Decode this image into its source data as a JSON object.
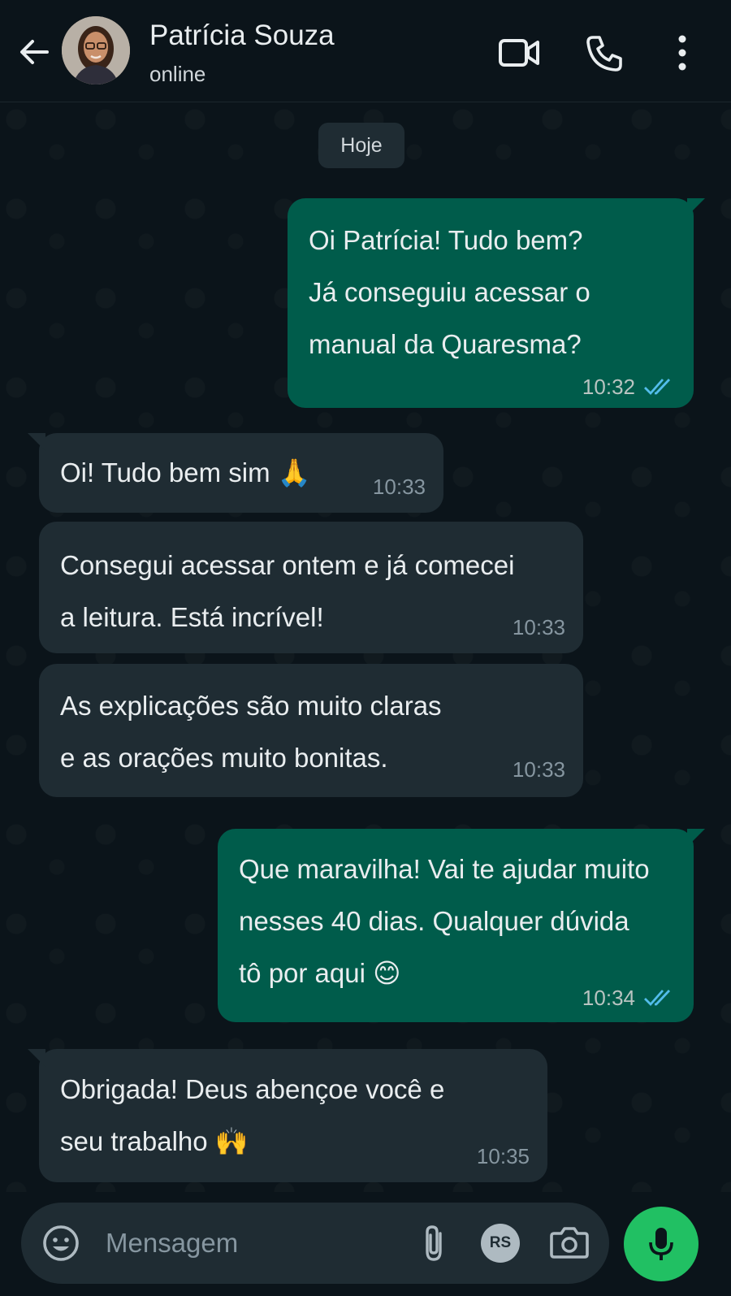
{
  "header": {
    "contact_name": "Patrícia Souza",
    "status": "online"
  },
  "chat": {
    "date_chip": "Hoje",
    "messages": [
      {
        "direction": "out",
        "text": "Oi Patrícia! Tudo bem?\nJá conseguiu acessar o\nmanual da Quaresma?",
        "time": "10:32",
        "ticks": "read"
      },
      {
        "direction": "in",
        "text": "Oi! Tudo bem sim 🙏",
        "time": "10:33"
      },
      {
        "direction": "in",
        "text": "Consegui acessar ontem e já comecei\na leitura. Está incrível!",
        "time": "10:33"
      },
      {
        "direction": "in",
        "text": "As explicações são muito claras\ne as orações muito bonitas.",
        "time": "10:33"
      },
      {
        "direction": "out",
        "text": "Que maravilha! Vai te ajudar muito\nnesses 40 dias. Qualquer dúvida\ntô por aqui 😊",
        "time": "10:34",
        "ticks": "read"
      },
      {
        "direction": "in",
        "text": "Obrigada! Deus abençoe você e\nseu trabalho 🙌",
        "time": "10:35"
      }
    ]
  },
  "input": {
    "placeholder": "Mensagem",
    "sticker_label": "RS"
  },
  "colors": {
    "background": "#0b141a",
    "outgoing_bubble": "#005c4b",
    "incoming_bubble": "#1f2c33",
    "read_ticks": "#53bdeb",
    "accent": "#21c063"
  }
}
